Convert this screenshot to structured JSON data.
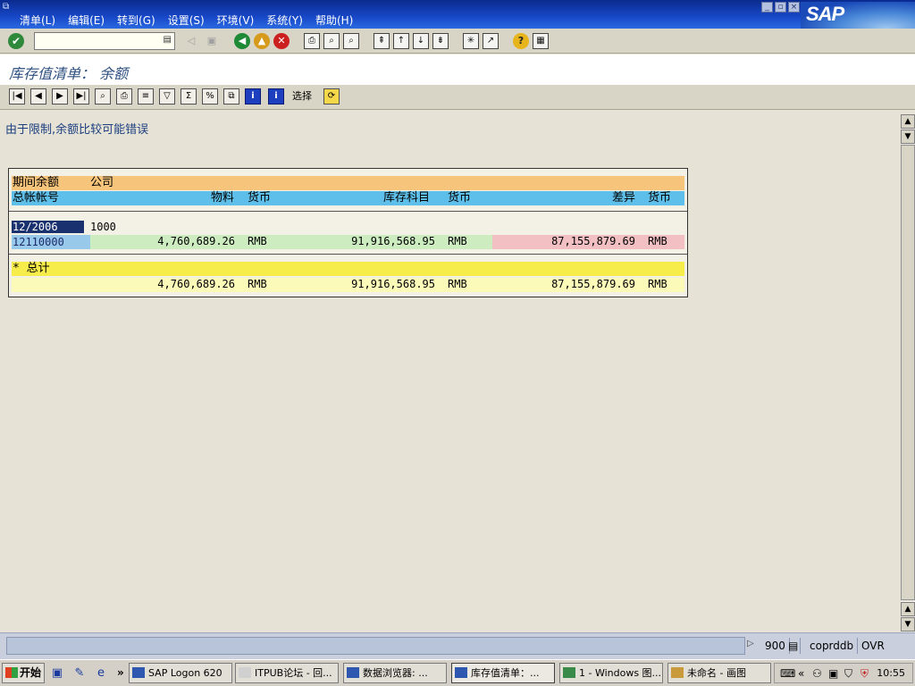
{
  "menubar": {
    "items": [
      "清单(L)",
      "编辑(E)",
      "转到(G)",
      "设置(S)",
      "环境(V)",
      "系统(Y)",
      "帮助(H)"
    ],
    "logo": "SAP"
  },
  "title": "库存值清单：  余额",
  "app_toolbar": {
    "select_label": "选择"
  },
  "notice": "由于限制,余额比较可能错误",
  "report": {
    "header1": {
      "c1": "期间余额",
      "c2": "公司"
    },
    "header2": {
      "c1": "总帐帐号",
      "material": "物料",
      "currency1": "货币",
      "stock_account": "库存科目",
      "currency2": "货币",
      "difference": "差异",
      "currency3": "货币"
    },
    "period": "12/2006",
    "company": "1000",
    "row": {
      "account": "12110000",
      "material": "4,760,689.26",
      "currency1": "RMB",
      "stock": "91,916,568.95",
      "currency2": "RMB",
      "difference": "87,155,879.69",
      "currency3": "RMB"
    },
    "total_label": "* 总计",
    "total": {
      "material": "4,760,689.26",
      "currency1": "RMB",
      "stock": "91,916,568.95",
      "currency2": "RMB",
      "difference": "87,155,879.69",
      "currency3": "RMB"
    }
  },
  "statusbar": {
    "client": "900",
    "server": "coprddb",
    "mode": "OVR"
  },
  "taskbar": {
    "start": "开始",
    "tasks": [
      "SAP Logon 620",
      "ITPUB论坛 - 回...",
      "数据浏览器: ...",
      "库存值清单：...",
      "1 - Windows 图...",
      "未命名 - 画图"
    ],
    "clock": "10:55"
  }
}
